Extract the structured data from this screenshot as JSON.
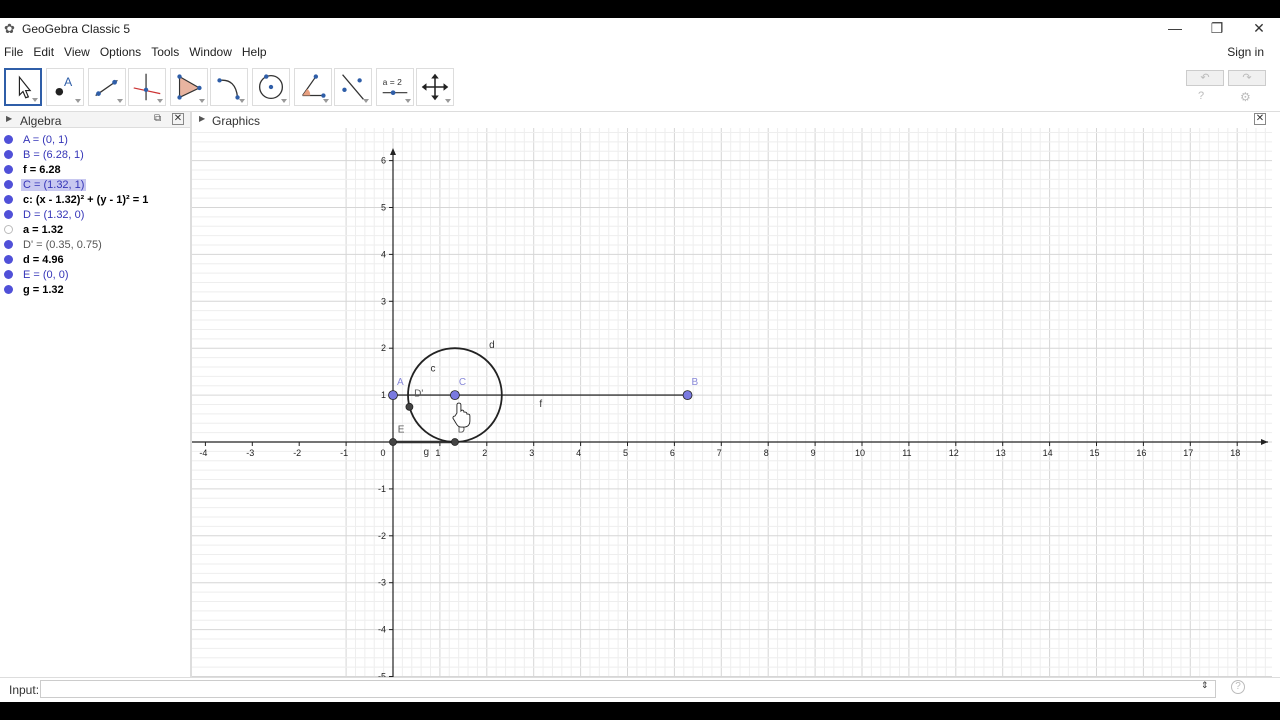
{
  "window": {
    "title": "GeoGebra Classic 5",
    "minimize": "—",
    "restore": "❐",
    "close": "✕"
  },
  "menu": [
    "File",
    "Edit",
    "View",
    "Options",
    "Tools",
    "Window",
    "Help"
  ],
  "sign_in": "Sign in",
  "toolbar": {
    "slider_tool_label": "a = 2",
    "undo_icon": "undo-icon",
    "redo_icon": "redo-icon"
  },
  "algebra": {
    "title": "Algebra",
    "items": [
      {
        "text": "A = (0, 1)",
        "style": "blue",
        "dot": "filled"
      },
      {
        "text": "B = (6.28, 1)",
        "style": "blue",
        "dot": "filled"
      },
      {
        "text": "f = 6.28",
        "style": "black",
        "dot": "filled"
      },
      {
        "text": "C = (1.32, 1)",
        "style": "blue sel",
        "dot": "filled"
      },
      {
        "text": "c: (x - 1.32)² + (y - 1)² = 1",
        "style": "black",
        "dot": "filled"
      },
      {
        "text": "D = (1.32, 0)",
        "style": "blue",
        "dot": "filled"
      },
      {
        "text": "a = 1.32",
        "style": "black",
        "dot": "hollow"
      },
      {
        "text": "D' = (0.35, 0.75)",
        "style": "grey",
        "dot": "filled"
      },
      {
        "text": "d = 4.96",
        "style": "black",
        "dot": "filled"
      },
      {
        "text": "E = (0, 0)",
        "style": "blue",
        "dot": "filled"
      },
      {
        "text": "g = 1.32",
        "style": "black",
        "dot": "filled"
      }
    ]
  },
  "graphics": {
    "title": "Graphics",
    "x_ticks": [
      "-4",
      "-3",
      "-2",
      "-1",
      "0",
      "1",
      "2",
      "3",
      "4",
      "5",
      "6",
      "7",
      "8",
      "9",
      "10",
      "11",
      "12",
      "13",
      "14",
      "15",
      "16",
      "17",
      "18"
    ],
    "y_ticks": [
      "-5",
      "-4",
      "-3",
      "-2",
      "-1",
      "1",
      "2",
      "3",
      "4",
      "5",
      "6"
    ],
    "labels": {
      "A": "A",
      "B": "B",
      "C": "C",
      "c": "c",
      "d": "d",
      "f": "f",
      "Dp": "D'",
      "D": "D",
      "E": "E",
      "g": "g"
    }
  },
  "input": {
    "label": "Input:",
    "value": ""
  },
  "colors": {
    "point": "#5050d8",
    "selection": "#c8c8f0",
    "accent": "#2f5ea8"
  }
}
